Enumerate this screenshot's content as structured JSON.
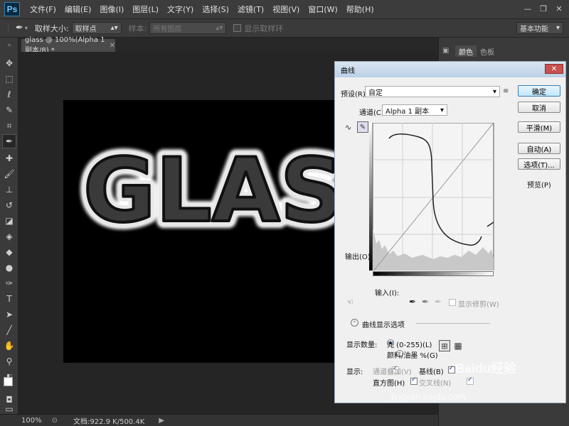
{
  "app": {
    "logo": "Ps"
  },
  "menubar": {
    "items": [
      "文件(F)",
      "编辑(E)",
      "图像(I)",
      "图层(L)",
      "文字(Y)",
      "选择(S)",
      "滤镜(T)",
      "视图(V)",
      "窗口(W)",
      "帮助(H)"
    ]
  },
  "options": {
    "sample_size_label": "取样大小:",
    "sample_size_value": "取样点",
    "sample_label": "样本:",
    "sample_value": "所有图层",
    "show_ring_label": "显示取样环",
    "workspace_value": "基本功能"
  },
  "document": {
    "tab_title": "glass @ 100%(Alpha 1 副本/8) *",
    "canvas_text": "GLASS"
  },
  "status": {
    "zoom": "100%",
    "doc_info": "文档:922.9 K/500.4K"
  },
  "panels": {
    "tabs": [
      "颜色",
      "色板"
    ]
  },
  "curves_dialog": {
    "title": "曲线",
    "preset_label": "预设(R):",
    "preset_value": "自定",
    "channel_label": "通道(C):",
    "channel_value": "Alpha 1 副本",
    "output_label": "输出(O):",
    "input_label": "输入(I):",
    "show_clipping_label": "显示修剪(W)",
    "curve_display_options_label": "曲线显示选项",
    "show_amount_label": "显示数量:",
    "light_option": "光 (0-255)(L)",
    "pigment_option": "颜料/油墨 %(G)",
    "show_label": "显示:",
    "channel_overlay_label": "通道叠加(V)",
    "baseline_label": "基线(B)",
    "histogram_label": "直方图(H)",
    "intersection_label": "交叉线(N)",
    "buttons": {
      "ok": "确定",
      "cancel": "取消",
      "smooth": "平滑(M)",
      "auto": "自动(A)",
      "options": "选项(T)...",
      "preview": "预览(P)"
    }
  },
  "watermark": {
    "brand": "Baidu经验",
    "url": "jingyan.baidu.com"
  }
}
